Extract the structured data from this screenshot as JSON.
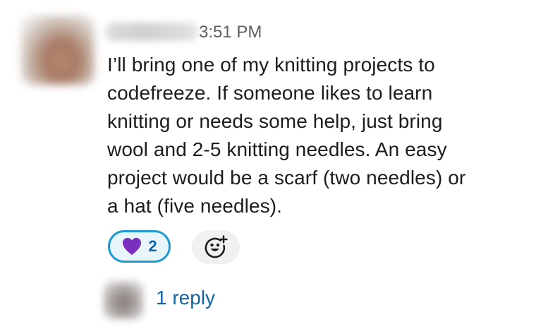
{
  "message": {
    "timestamp": "3:51 PM",
    "body_lines": [
      "I’ll bring one of my knitting projects to",
      "codefreeze. If someone likes to learn",
      "knitting or needs some help, just bring",
      "wool and 2-5 knitting needles. An easy",
      "project would be a scarf (two needles) or",
      "a hat (five needles)."
    ],
    "reactions": [
      {
        "emoji": "purple-heart-icon",
        "count": "2",
        "selected": true,
        "color": "#7b2fbe"
      }
    ],
    "add_reaction_icon": "add-emoji-icon",
    "thread": {
      "reply_label": "1 reply"
    }
  },
  "colors": {
    "accent_border": "#1d9bd1",
    "link": "#1264a3",
    "text": "#1d1c1d",
    "muted": "#616061"
  }
}
